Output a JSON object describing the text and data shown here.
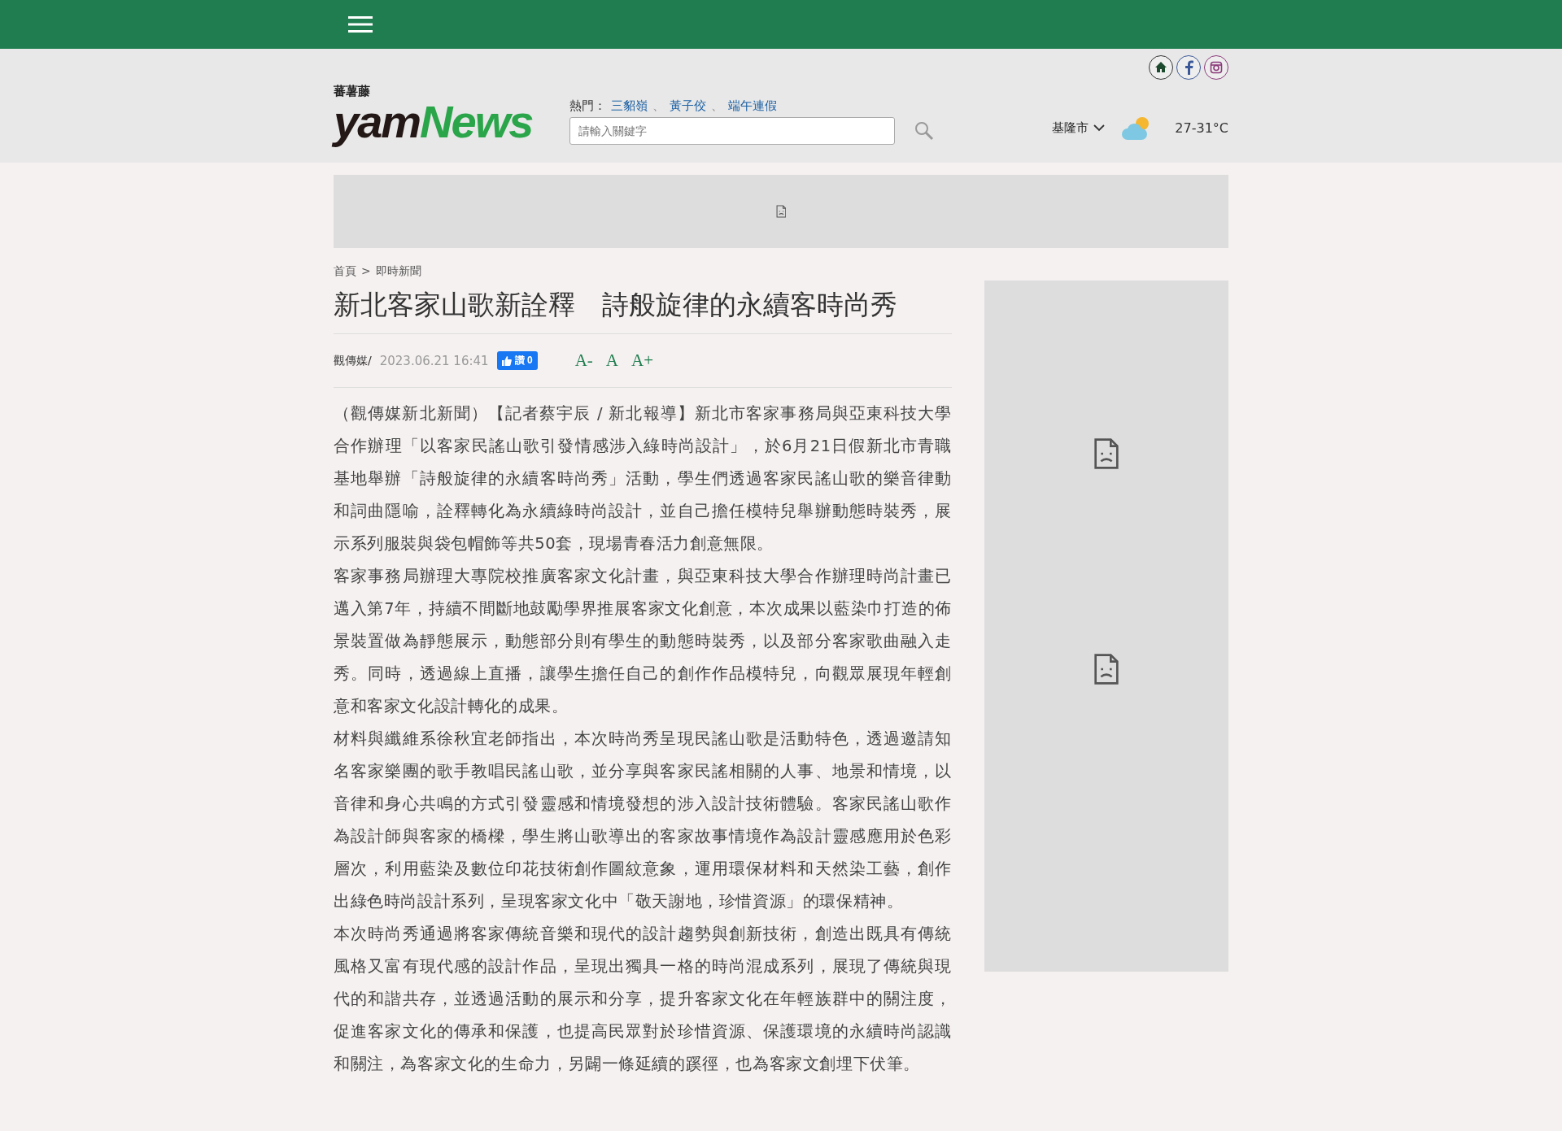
{
  "header": {
    "logo": {
      "small": "蕃薯藤",
      "main_a": "yam",
      "main_b": "News"
    },
    "hot": {
      "label": "熱門：",
      "topics": [
        "三貂嶺",
        "黃子佼",
        "端午連假"
      ],
      "separator": "、"
    },
    "search": {
      "placeholder": "請輸入關鍵字"
    },
    "weather": {
      "city": "基隆市",
      "temp": "27-31°C"
    }
  },
  "breadcrumb": {
    "items": [
      "首頁",
      "即時新聞"
    ],
    "separator": ">"
  },
  "article": {
    "title": "新北客家山歌新詮釋　詩般旋律的永續客時尚秀",
    "source": "觀傳媒/",
    "date": "2023.06.21 16:41",
    "like": {
      "label": "讚",
      "count": "0"
    },
    "font_sizes": [
      {
        "label": "A-",
        "selected": false
      },
      {
        "label": "A",
        "selected": false
      },
      {
        "label": "A+",
        "selected": false
      }
    ],
    "paragraphs": [
      "（觀傳媒新北新聞）【記者蔡宇辰 / 新北報導】新北市客家事務局與亞東科技大學合作辦理「以客家民謠山歌引發情感涉入綠時尚設計」，於6月21日假新北市青職基地舉辦「詩般旋律的永續客時尚秀」活動，學生們透過客家民謠山歌的樂音律動和詞曲隱喻，詮釋轉化為永續綠時尚設計，並自己擔任模特兒舉辦動態時裝秀，展示系列服裝與袋包帽飾等共50套，現場青春活力創意無限。",
      "客家事務局辦理大專院校推廣客家文化計畫，與亞東科技大學合作辦理時尚計畫已邁入第7年，持續不間斷地鼓勵學界推展客家文化創意，本次成果以藍染巾打造的佈景裝置做為靜態展示，動態部分則有學生的動態時裝秀，以及部分客家歌曲融入走秀。同時，透過線上直播，讓學生擔任自己的創作作品模特兒，向觀眾展現年輕創意和客家文化設計轉化的成果。",
      "材料與纖維系徐秋宜老師指出，本次時尚秀呈現民謠山歌是活動特色，透過邀請知名客家樂團的歌手教唱民謠山歌，並分享與客家民謠相關的人事、地景和情境，以音律和身心共鳴的方式引發靈感和情境發想的涉入設計技術體驗。客家民謠山歌作為設計師與客家的橋樑，學生將山歌導出的客家故事情境作為設計靈感應用於色彩層次，利用藍染及數位印花技術創作圖紋意象，運用環保材料和天然染工藝，創作出綠色時尚設計系列，呈現客家文化中「敬天謝地，珍惜資源」的環保精神。",
      "本次時尚秀通過將客家傳統音樂和現代的設計趨勢與創新技術，創造出既具有傳統風格又富有現代感的設計作品，呈現出獨具一格的時尚混成系列，展現了傳統與現代的和諧共存，並透過活動的展示和分享，提升客家文化在年輕族群中的關注度，促進客家文化的傳承和保護，也提高民眾對於珍惜資源、保護環境的永續時尚認識和關注，為客家文化的生命力，另闢一條延續的蹊徑，也為客家文創埋下伏筆。"
    ]
  }
}
